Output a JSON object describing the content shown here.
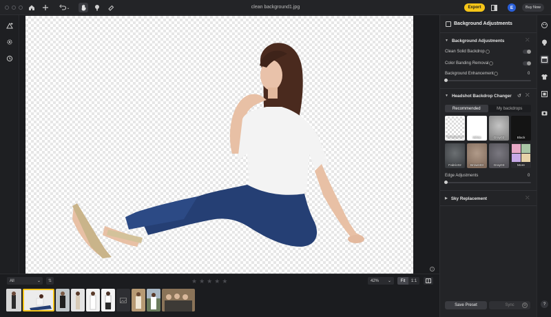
{
  "window": {
    "title": "clean background1.jpg"
  },
  "toolbar": {
    "export_label": "Export",
    "avatar_initial": "E",
    "buy_now_label": "Buy Now",
    "icons": [
      "home-icon",
      "plus-icon",
      "undo-icon",
      "chevron-down-icon",
      "hand-icon",
      "brush-icon",
      "eraser-icon"
    ]
  },
  "bottom": {
    "filter_value": "All",
    "rating_stars": 5,
    "zoom_value": "42%",
    "fit_label": "Fit",
    "one_to_one_label": "1:1"
  },
  "panel": {
    "title": "Background Adjustments",
    "bg_adjust": {
      "section_title": "Background Adjustments",
      "clean_solid_backdrop_label": "Clean Solid Backdrop",
      "color_banding_removal_label": "Color Banding Removal",
      "background_enhancement_label": "Background Enhancement",
      "background_enhancement_value": "0"
    },
    "headshot": {
      "section_title": "Headshot Backdrop Changer",
      "tab_recommended": "Recommended",
      "tab_my_backdrops": "My backdrops",
      "swatches": [
        {
          "label": "Transparent",
          "color": "#e9e9e9"
        },
        {
          "label": "White",
          "color": "#ffffff"
        },
        {
          "label": "Gray02",
          "color": "#9a9a9a"
        },
        {
          "label": "Black",
          "color": "#161616"
        },
        {
          "label": "Fabric02",
          "color": "#4a4d4f"
        },
        {
          "label": "Brown03",
          "color": "#8e7868"
        },
        {
          "label": "Gray03",
          "color": "#5d5c62"
        },
        {
          "label": "More",
          "color": "#3a3b40"
        }
      ],
      "edge_adjustments_label": "Edge Adjustments",
      "edge_adjustments_value": "0"
    },
    "sky": {
      "section_title": "Sky Replacement"
    },
    "save_preset_label": "Save Preset",
    "sync_label": "Sync"
  },
  "help_label": "?",
  "colors": {
    "accent": "#f5c518",
    "avatar": "#2a5fd8"
  }
}
